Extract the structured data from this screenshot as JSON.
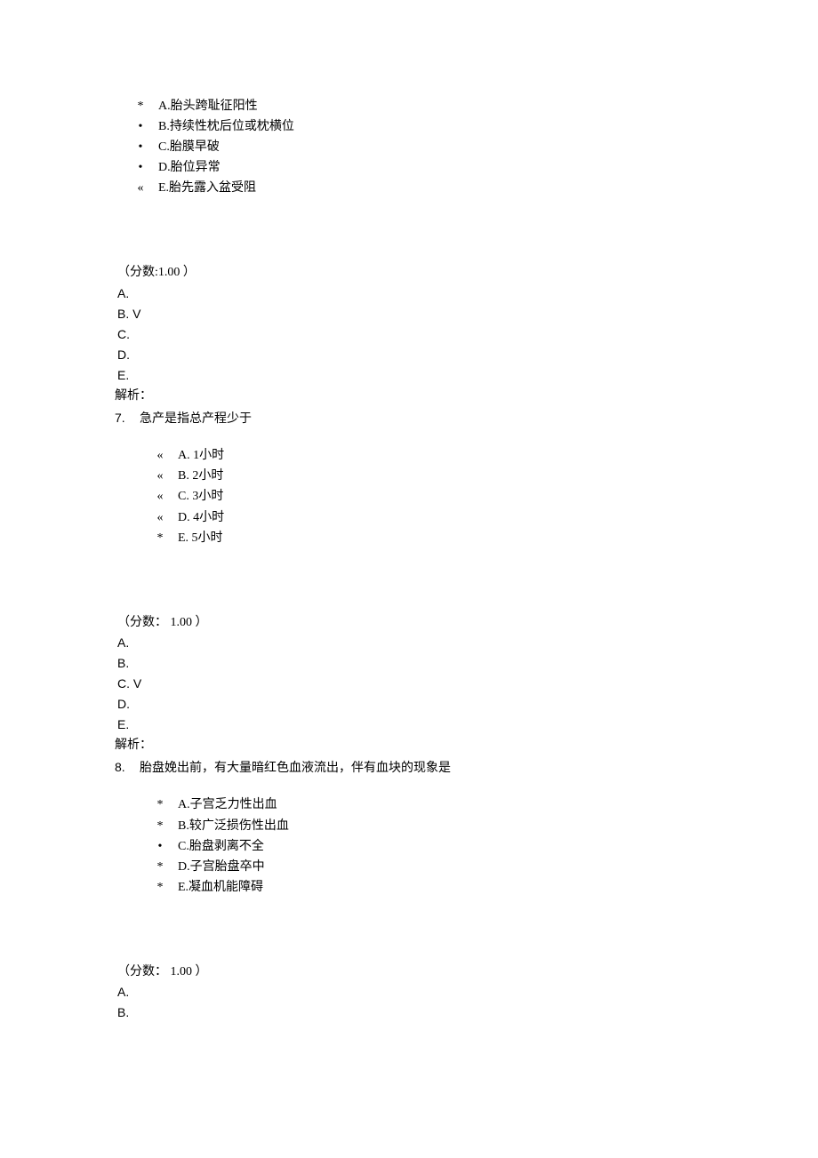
{
  "q6": {
    "options": [
      {
        "bullet": "*",
        "text": "A.胎头跨耻征阳性"
      },
      {
        "bullet": "•",
        "text": "B.持续性枕后位或枕横位"
      },
      {
        "bullet": "•",
        "text": "C.胎膜早破"
      },
      {
        "bullet": "•",
        "text": "D.胎位异常"
      },
      {
        "bullet": "«",
        "text": "E.胎先露入盆受阻"
      }
    ],
    "score_label": "（分数:1.00 ）",
    "answers": [
      "A.",
      "B.    V",
      "C.",
      "D.",
      "E."
    ],
    "explain": "解析："
  },
  "q7": {
    "num": "7.",
    "stem": "急产是指总产程少于",
    "options": [
      {
        "bullet": "«",
        "text": "A. 1小时"
      },
      {
        "bullet": "«",
        "text": "B. 2小时"
      },
      {
        "bullet": "«",
        "text": "C. 3小时"
      },
      {
        "bullet": "«",
        "text": "D. 4小时"
      },
      {
        "bullet": "*",
        "text": "E. 5小时"
      }
    ],
    "score_label": "（分数： 1.00 ）",
    "answers": [
      "A.",
      "B.",
      "C.    V",
      "D.",
      "E."
    ],
    "explain": "解析："
  },
  "q8": {
    "num": "8.",
    "stem": "胎盘娩出前，有大量暗红色血液流出，伴有血块的现象是",
    "options": [
      {
        "bullet": "*",
        "text": "A.子宫乏力性出血"
      },
      {
        "bullet": "*",
        "text": "B.较广泛损伤性出血"
      },
      {
        "bullet": "•",
        "text": "C.胎盘剥离不全"
      },
      {
        "bullet": "*",
        "text": "D.子宫胎盘卒中"
      },
      {
        "bullet": "*",
        "text": "E.凝血机能障碍"
      }
    ],
    "score_label": "（分数： 1.00 ）",
    "answers": [
      "A.",
      "B."
    ]
  }
}
